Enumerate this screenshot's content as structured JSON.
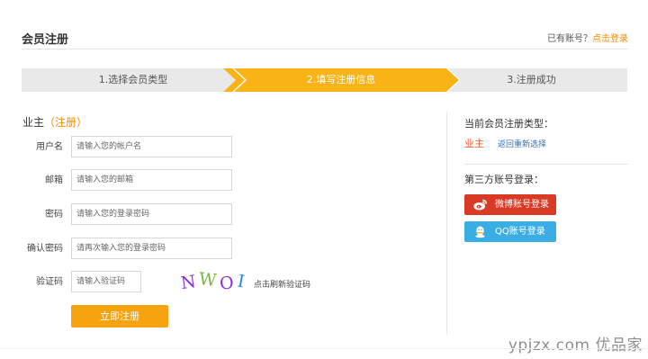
{
  "header": {
    "title": "会员注册",
    "login_prompt": "已有账号？",
    "login_link": "点击登录"
  },
  "steps": [
    {
      "label": "1.选择会员类型",
      "state": "done"
    },
    {
      "label": "2.填写注册信息",
      "state": "active"
    },
    {
      "label": "3.注册成功",
      "state": "pending"
    }
  ],
  "form": {
    "section_label": "业主",
    "section_tag": "（注册）",
    "fields": [
      {
        "label": "用户名",
        "placeholder": "请输入您的帐户名",
        "value": ""
      },
      {
        "label": "邮箱",
        "placeholder": "请输入您的邮箱",
        "value": ""
      },
      {
        "label": "密码",
        "placeholder": "请输入您的登录密码",
        "value": ""
      },
      {
        "label": "确认密码",
        "placeholder": "请再次输入您的登录密码",
        "value": ""
      },
      {
        "label": "验证码",
        "placeholder": "请输入验证码",
        "value": ""
      }
    ],
    "captcha_chars": [
      "N",
      "W",
      "O",
      "I"
    ],
    "refresh_captcha": "点击刷新验证码",
    "submit_label": "立即注册"
  },
  "sidebar": {
    "current_type_title": "当前会员注册类型：",
    "current_type": "业主",
    "reselect": "返回重新选择",
    "third_party_title": "第三方账号登录：",
    "weibo_label": "微博账号登录",
    "qq_label": "QQ账号登录"
  },
  "watermark": "ypjzx.com 优品家",
  "colors": {
    "accent": "#f9b316",
    "link_orange": "#f08c00",
    "weibo_red": "#d93a25",
    "qq_blue": "#3aaee4"
  },
  "icons": {
    "weibo": "weibo-icon",
    "qq": "qq-penguin-icon"
  }
}
